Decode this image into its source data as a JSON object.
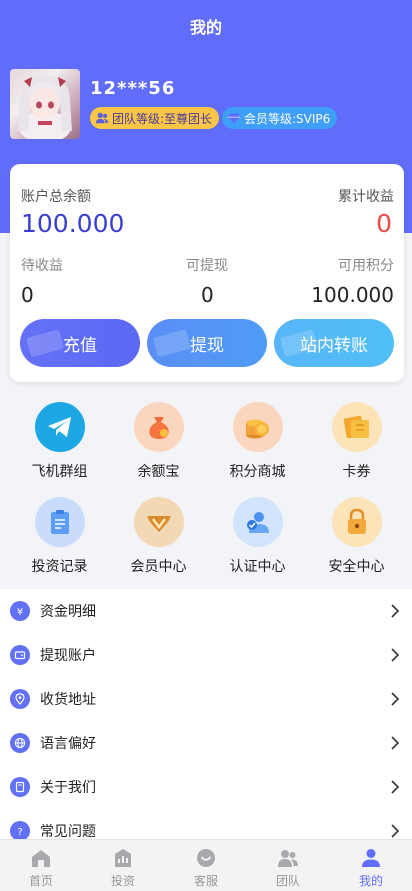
{
  "header": {
    "title": "我的"
  },
  "profile": {
    "username": "12***56",
    "team_badge": "团队等级:至尊团长",
    "vip_badge": "会员等级:SVIP6"
  },
  "account": {
    "total_label": "账户总余额",
    "total_value": "100.000",
    "cumulative_label": "累计收益",
    "cumulative_value": "0",
    "pending_label": "待收益",
    "pending_value": "0",
    "withdrawable_label": "可提现",
    "withdrawable_value": "0",
    "points_label": "可用积分",
    "points_value": "100.000",
    "buttons": {
      "recharge": "充值",
      "withdraw": "提现",
      "transfer": "站内转账"
    }
  },
  "grid": [
    {
      "label": "飞机群组",
      "icon": "telegram-icon"
    },
    {
      "label": "余额宝",
      "icon": "money-bag-icon"
    },
    {
      "label": "积分商城",
      "icon": "coins-icon"
    },
    {
      "label": "卡券",
      "icon": "ticket-icon"
    },
    {
      "label": "投资记录",
      "icon": "clipboard-icon"
    },
    {
      "label": "会员中心",
      "icon": "crown-v-icon"
    },
    {
      "label": "认证中心",
      "icon": "verified-user-icon"
    },
    {
      "label": "安全中心",
      "icon": "padlock-icon"
    }
  ],
  "menu": [
    {
      "label": "资金明细",
      "icon": "money-icon"
    },
    {
      "label": "提现账户",
      "icon": "wallet-icon"
    },
    {
      "label": "收货地址",
      "icon": "location-icon"
    },
    {
      "label": "语言偏好",
      "icon": "globe-icon"
    },
    {
      "label": "关于我们",
      "icon": "info-book-icon"
    },
    {
      "label": "常见问题",
      "icon": "question-icon"
    }
  ],
  "tabbar": [
    {
      "label": "首页",
      "icon": "home-icon"
    },
    {
      "label": "投资",
      "icon": "invest-icon"
    },
    {
      "label": "客服",
      "icon": "service-icon"
    },
    {
      "label": "团队",
      "icon": "team-icon"
    },
    {
      "label": "我的",
      "icon": "user-icon",
      "active": true
    }
  ],
  "colors": {
    "brand": "#5f6dfa",
    "accent_red": "#f14a47",
    "total_blue": "#3b3fd0"
  }
}
